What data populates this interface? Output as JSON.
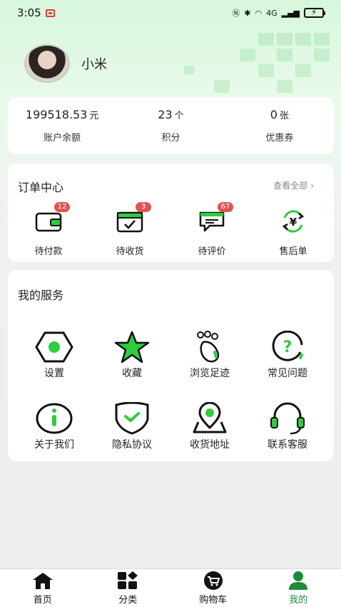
{
  "status_bar": {
    "time": "3:05",
    "network": "4G"
  },
  "profile": {
    "username": "小米"
  },
  "account": {
    "stats": [
      {
        "value": "199518.53",
        "unit": "元",
        "label": "账户余额"
      },
      {
        "value": "23",
        "unit": "个",
        "label": "积分"
      },
      {
        "value": "0",
        "unit": "张",
        "label": "优惠券"
      }
    ]
  },
  "orders": {
    "title": "订单中心",
    "view_all": "查看全部",
    "items": [
      {
        "label": "待付款",
        "badge": "12",
        "icon": "wallet-icon"
      },
      {
        "label": "待收货",
        "badge": "3",
        "icon": "box-check-icon"
      },
      {
        "label": "待评价",
        "badge": "67",
        "icon": "chat-icon"
      },
      {
        "label": "售后单",
        "badge": "",
        "icon": "yuan-refund-icon"
      }
    ]
  },
  "services": {
    "title": "我的服务",
    "items": [
      {
        "label": "设置",
        "icon": "hexagon-settings-icon"
      },
      {
        "label": "收藏",
        "icon": "star-icon"
      },
      {
        "label": "浏览足迹",
        "icon": "footprint-icon"
      },
      {
        "label": "常见问题",
        "icon": "question-icon"
      },
      {
        "label": "关于我们",
        "icon": "info-icon"
      },
      {
        "label": "隐私协议",
        "icon": "shield-icon"
      },
      {
        "label": "收货地址",
        "icon": "location-icon"
      },
      {
        "label": "联系客服",
        "icon": "headset-icon"
      }
    ]
  },
  "tabbar": {
    "tabs": [
      {
        "label": "首页",
        "icon": "home-icon"
      },
      {
        "label": "分类",
        "icon": "category-icon"
      },
      {
        "label": "购物车",
        "icon": "cart-icon"
      },
      {
        "label": "我的",
        "icon": "user-icon",
        "active": true
      }
    ]
  },
  "colors": {
    "accent": "#1f8b3a",
    "bright_green": "#2ecc40",
    "badge": "#e05353"
  }
}
